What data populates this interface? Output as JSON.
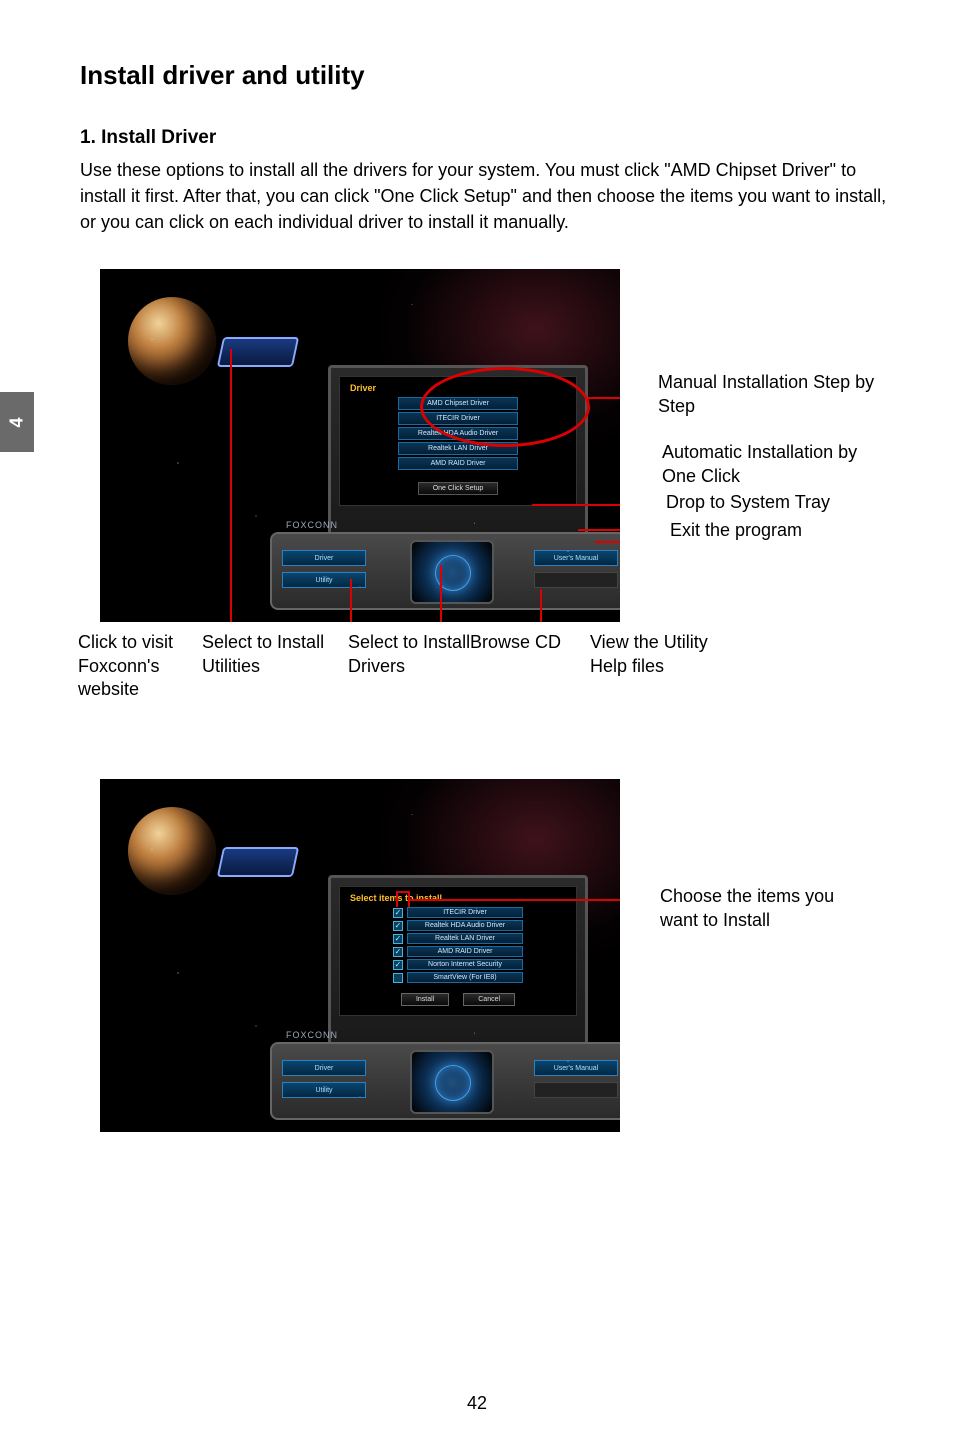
{
  "sideTab": "4",
  "title": "Install driver and utility",
  "section": {
    "heading": "1. Install Driver",
    "body": "Use these options to install all the drivers for your system. You must click \"AMD Chipset Driver\" to install it first. After that, you can click \"One Click Setup\" and then choose the items you want to install, or you can click on each individual driver to install it manually."
  },
  "figure1": {
    "panelTitle": "Driver",
    "drivers": [
      "AMD Chipset Driver",
      "ITECIR Driver",
      "Realtek HDA Audio Driver",
      "Realtek LAN Driver",
      "AMD RAID Driver"
    ],
    "oneClick": "One Click Setup",
    "consoleBrand": "FOXCONN",
    "leftButtons": [
      "Driver",
      "Utility"
    ],
    "rightButtons": [
      "User's Manual",
      ""
    ],
    "callouts": {
      "manual": "Manual Installation Step by Step",
      "auto": "Automatic Installation by One Click",
      "tray": "Drop to System Tray",
      "exit": "Exit the program",
      "website": "Click to visit Foxconn's website",
      "utilities": "Select to Install Utilities",
      "drivers": "Select to Install Drivers",
      "browse": "Browse CD",
      "help": "View the Utility Help files"
    }
  },
  "figure2": {
    "panelTitle": "Select items to install",
    "items": [
      "ITECIR Driver",
      "Realtek HDA Audio Driver",
      "Realtek LAN Driver",
      "AMD RAID Driver",
      "Norton Internet Security",
      "SmartView (For IE8)"
    ],
    "install": "Install",
    "cancel": "Cancel",
    "consoleBrand": "FOXCONN",
    "leftButtons": [
      "Driver",
      "Utility"
    ],
    "rightButtons": [
      "User's Manual",
      ""
    ],
    "callout": "Choose the items you want to Install"
  },
  "pageNumber": "42"
}
